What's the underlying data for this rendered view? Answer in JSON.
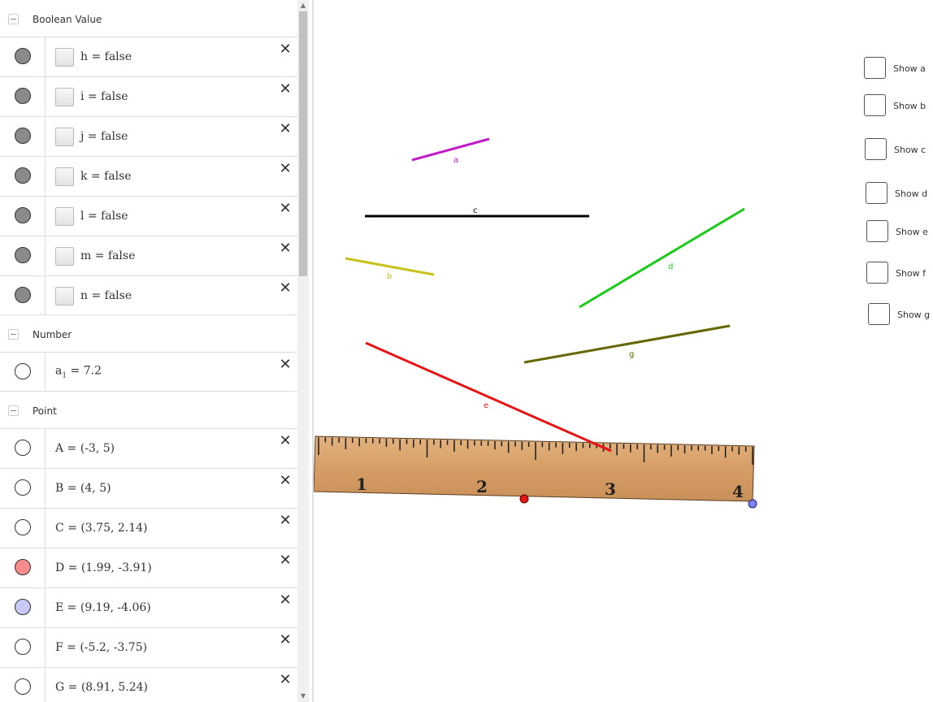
{
  "algebra": {
    "groups": {
      "boolean": {
        "label": "Boolean Value"
      },
      "number": {
        "label": "Number"
      },
      "point": {
        "label": "Point"
      }
    },
    "booleans": [
      {
        "expr": "h = false"
      },
      {
        "expr": "i = false"
      },
      {
        "expr": "j = false"
      },
      {
        "expr": "k = false"
      },
      {
        "expr": "l = false"
      },
      {
        "expr": "m = false"
      },
      {
        "expr": "n = false"
      }
    ],
    "numbers": [
      {
        "expr_main": "a",
        "expr_sub": "1",
        "expr_rest": " = 7.2"
      }
    ],
    "points": [
      {
        "expr": "A = (-3, 5)",
        "color": "#ffffff"
      },
      {
        "expr": "B = (4, 5)",
        "color": "#ffffff"
      },
      {
        "expr": "C = (3.75, 2.14)",
        "color": "#ffffff"
      },
      {
        "expr": "D = (1.99, -3.91)",
        "color": "#f58b8b"
      },
      {
        "expr": "E = (9.19, -4.06)",
        "color": "#c8c8f5"
      },
      {
        "expr": "F = (-5.2, -3.75)",
        "color": "#ffffff"
      },
      {
        "expr": "G = (8.91, 5.24)",
        "color": "#ffffff"
      }
    ],
    "delete_glyph": "✕"
  },
  "graphics": {
    "segments": [
      {
        "label": "a",
        "color": "#c21bc9"
      },
      {
        "label": "c",
        "color": "#000000"
      },
      {
        "label": "b",
        "color": "#c9c21b"
      },
      {
        "label": "d",
        "color": "#1bc91b"
      },
      {
        "label": "g",
        "color": "#666600"
      },
      {
        "label": "e",
        "color": "#e61414"
      }
    ],
    "ruler": {
      "numbers": [
        "1",
        "2",
        "3",
        "4"
      ],
      "color": "#d9a26c"
    },
    "checkboxes": [
      {
        "label": "Show a"
      },
      {
        "label": "Show b"
      },
      {
        "label": "Show c"
      },
      {
        "label": "Show d"
      },
      {
        "label": "Show e"
      },
      {
        "label": "Show f"
      },
      {
        "label": "Show g"
      }
    ]
  }
}
